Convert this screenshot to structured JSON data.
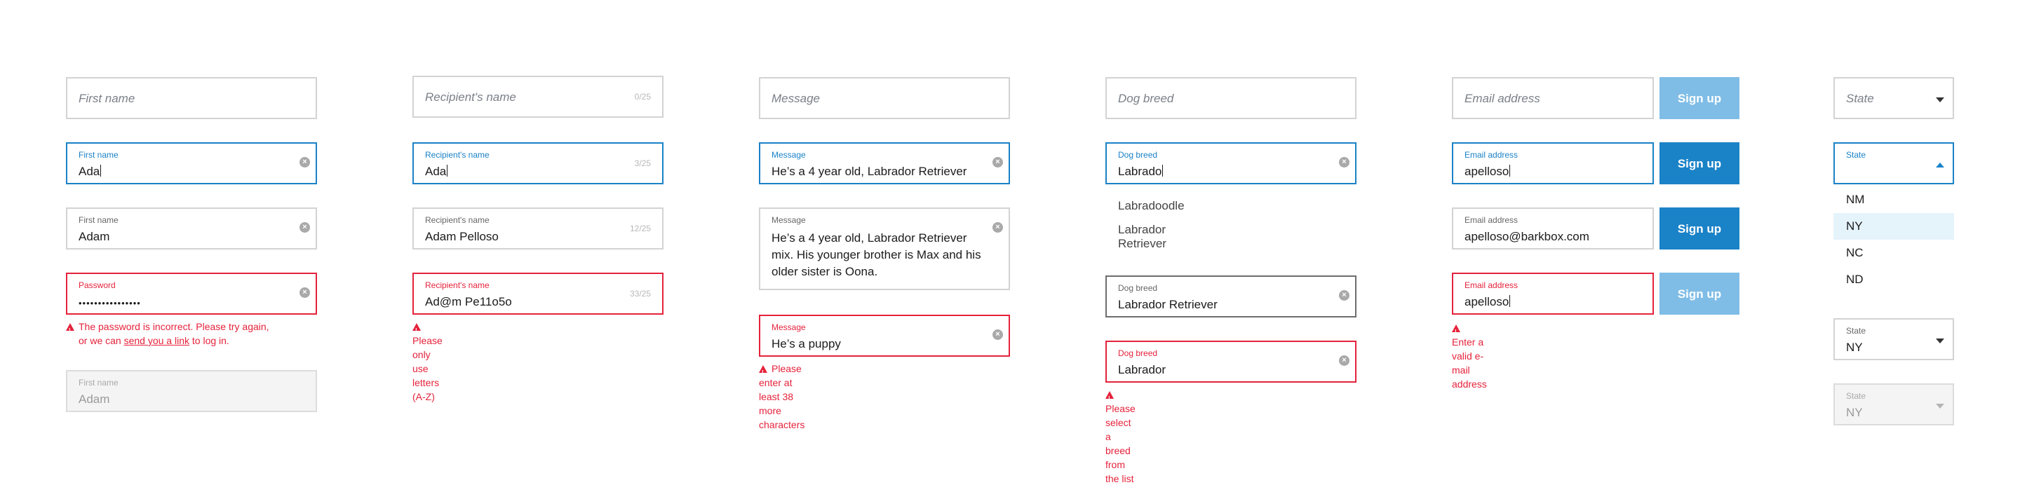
{
  "col1": {
    "placeholder": "First name",
    "focused": {
      "label": "First name",
      "value": "Ada"
    },
    "filled": {
      "label": "First name",
      "value": "Adam"
    },
    "error": {
      "label": "Password",
      "value": "••••••••••••••••",
      "msg_pre": "The password is incorrect. Please try again,",
      "msg_line2_pre": "or we can ",
      "msg_link": "send you a link",
      "msg_post": " to log in."
    },
    "disabled": {
      "label": "First name",
      "value": "Adam"
    }
  },
  "col2": {
    "placeholder": "Recipient's name",
    "counter_empty": "0/25",
    "focused": {
      "label": "Recipient's name",
      "value": "Ada",
      "counter": "3/25"
    },
    "filled": {
      "label": "Recipient's name",
      "value": "Adam Pelloso",
      "counter": "12/25"
    },
    "error": {
      "label": "Recipient's name",
      "value": "Ad@m Pe11o5o",
      "counter": "33/25",
      "msg": "Please only use letters (A-Z)"
    }
  },
  "col3": {
    "placeholder": "Message",
    "focused": {
      "label": "Message",
      "value": "He’s a 4 year old, Labrador Retriever"
    },
    "filled": {
      "label": "Message",
      "value": "He’s a 4 year old, Labrador Retriever mix. His younger brother is Max and his older sister is Oona."
    },
    "error": {
      "label": "Message",
      "value": "He’s a puppy",
      "msg": "Please enter at least 38 more characters"
    }
  },
  "col4": {
    "placeholder": "Dog breed",
    "focused": {
      "label": "Dog breed",
      "value": "Labrado"
    },
    "suggestions": [
      "Labradoodle",
      "Labrador Retriever"
    ],
    "filled": {
      "label": "Dog breed",
      "value": "Labrador Retriever"
    },
    "error": {
      "label": "Dog breed",
      "value": "Labrador",
      "msg": "Please select a breed from the list"
    }
  },
  "col5": {
    "placeholder": "Email address",
    "button": "Sign up",
    "focused": {
      "label": "Email address",
      "value": "apelloso"
    },
    "filled": {
      "label": "Email address",
      "value": "apelloso@barkbox.com"
    },
    "error": {
      "label": "Email address",
      "value": "apelloso",
      "msg": "Enter a valid e-mail address"
    }
  },
  "col6": {
    "placeholder": "State",
    "open": {
      "label": "State",
      "options": [
        "NM",
        "NY",
        "NC",
        "ND"
      ],
      "highlighted": "NY"
    },
    "filled": {
      "label": "State",
      "value": "NY"
    },
    "disabled": {
      "label": "State",
      "value": "NY"
    }
  },
  "colors": {
    "focus": "#1a82c7",
    "error": "#e5223b",
    "button_light": "#7fbde7",
    "button_solid": "#1a82c7"
  }
}
